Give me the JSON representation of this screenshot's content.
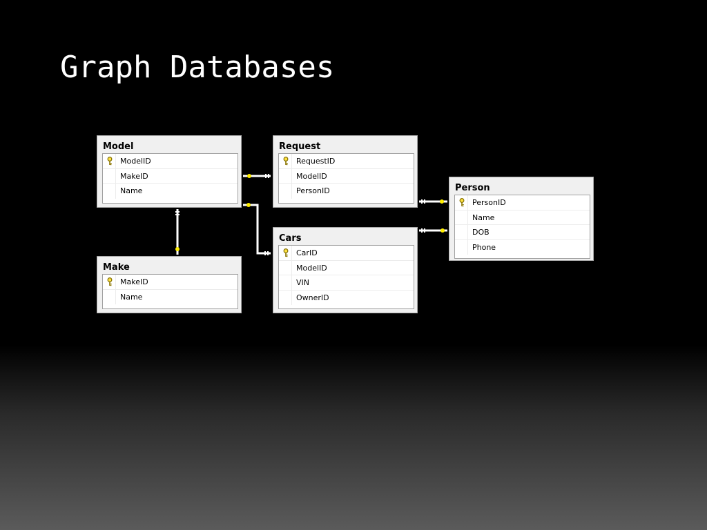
{
  "slide": {
    "title": "Graph Databases"
  },
  "tables": {
    "model": {
      "name": "Model",
      "columns": [
        "ModelID",
        "MakeID",
        "Name"
      ]
    },
    "request": {
      "name": "Request",
      "columns": [
        "RequestID",
        "ModelID",
        "PersonID"
      ]
    },
    "person": {
      "name": "Person",
      "columns": [
        "PersonID",
        "Name",
        "DOB",
        "Phone"
      ]
    },
    "make": {
      "name": "Make",
      "columns": [
        "MakeID",
        "Name"
      ]
    },
    "cars": {
      "name": "Cars",
      "columns": [
        "CarID",
        "ModelID",
        "VIN",
        "OwnerID"
      ]
    }
  },
  "primary_keys": {
    "model": "ModelID",
    "request": "RequestID",
    "person": "PersonID",
    "make": "MakeID",
    "cars": "CarID"
  },
  "relationships": [
    {
      "from": "Request",
      "to": "Model",
      "key_side": "Model"
    },
    {
      "from": "Cars",
      "to": "Model",
      "key_side": "Model"
    },
    {
      "from": "Model",
      "to": "Make",
      "key_side": "Make"
    },
    {
      "from": "Request",
      "to": "Person",
      "key_side": "Person"
    },
    {
      "from": "Cars",
      "to": "Person",
      "key_side": "Person"
    }
  ],
  "colors": {
    "connector": "#ffffff",
    "key": "#ffee00",
    "table_bg": "#f0f0f0",
    "background": "#000000"
  },
  "icons": {
    "primary_key": "key-icon"
  }
}
